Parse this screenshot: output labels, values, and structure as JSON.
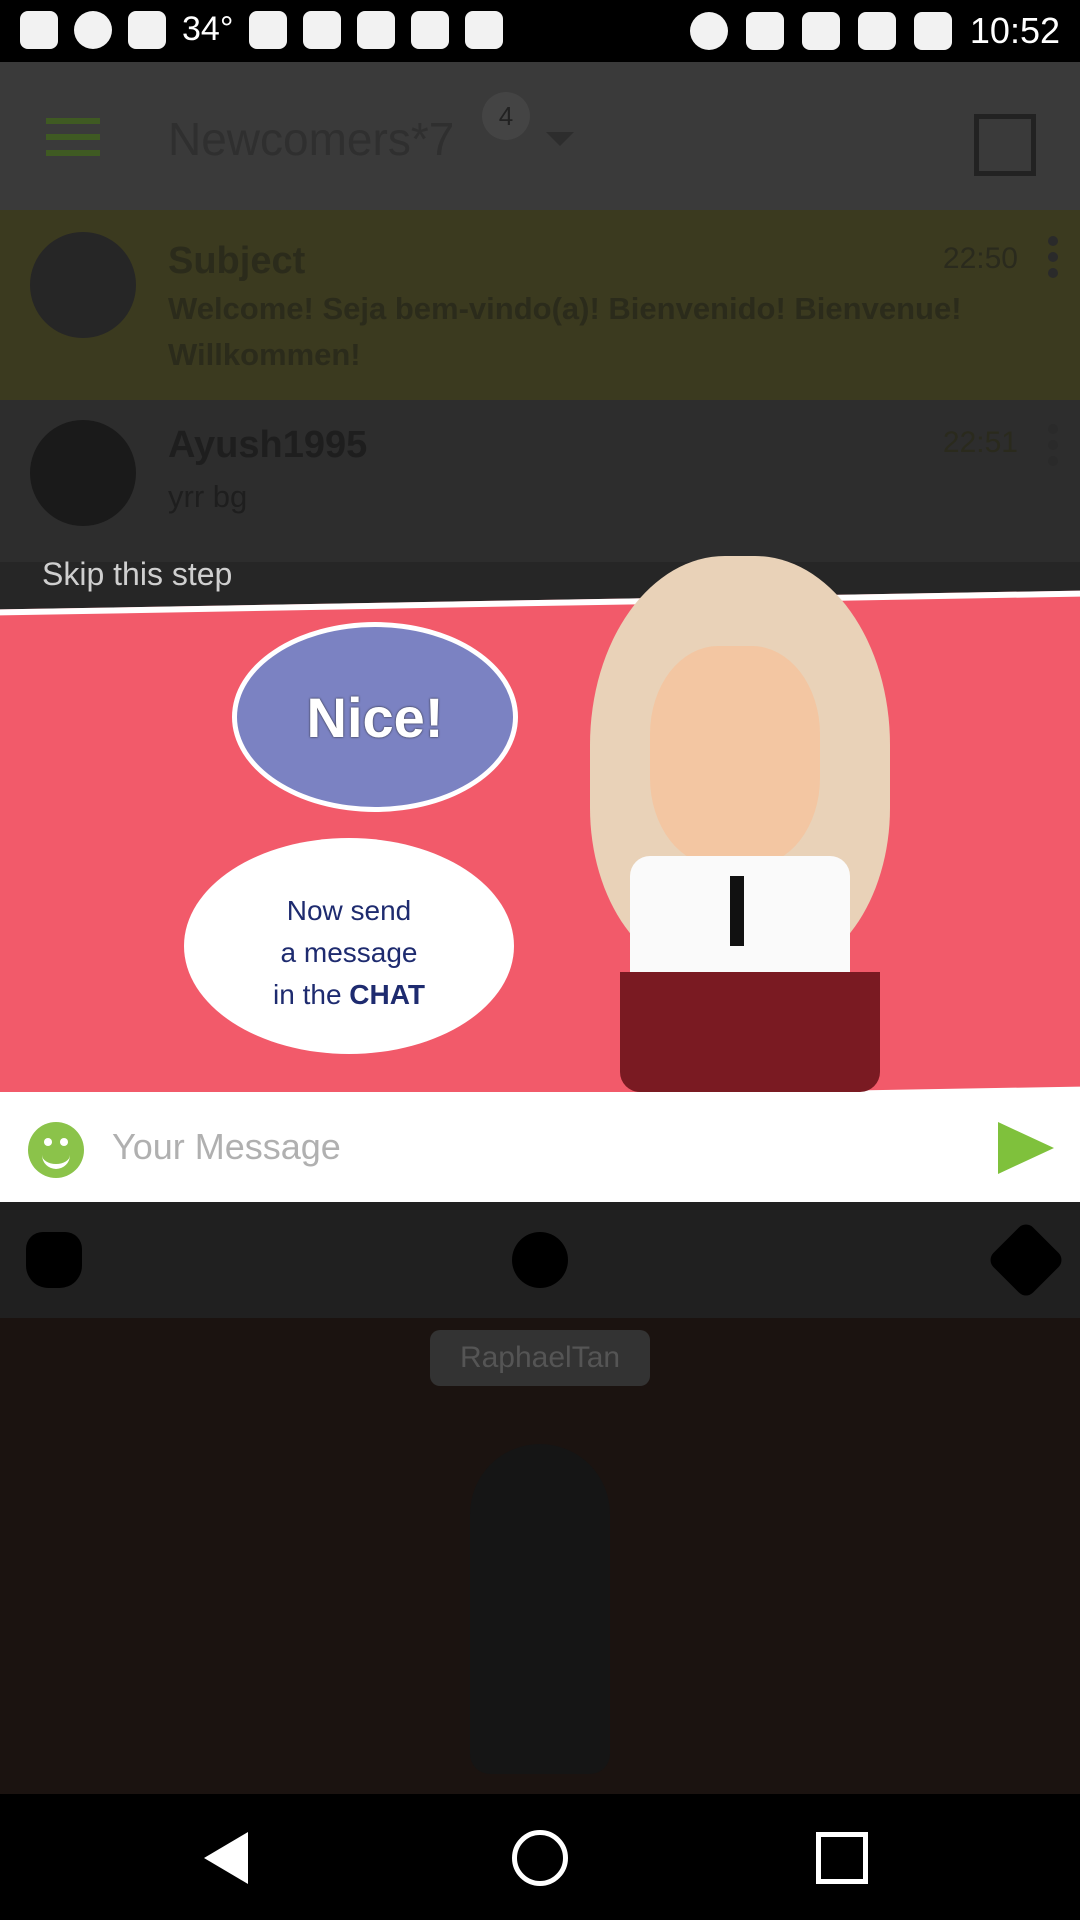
{
  "status_bar": {
    "temperature": "34°",
    "time": "10:52"
  },
  "header": {
    "title": "Newcomers*7",
    "badge_count": "4"
  },
  "conversations": [
    {
      "name": "Subject",
      "message": "Welcome! Seja bem-vindo(a)! Bienvenido! Bienvenue! Willkommen!",
      "time": "22:50"
    },
    {
      "name": "Ayush1995",
      "message": "yrr bg",
      "time": "22:51"
    }
  ],
  "tutorial": {
    "skip_label": "Skip this step",
    "bubble_nice": "Nice!",
    "bubble_line1": "Now send",
    "bubble_line2": "a message",
    "bubble_line3": "in the",
    "bubble_chat": "CHAT"
  },
  "composer": {
    "placeholder": "Your Message"
  },
  "profile": {
    "username": "RaphaelTan"
  },
  "icons": {
    "menu": "menu-icon",
    "copy": "copy-icon",
    "emoji": "emoji-icon",
    "send": "send-icon",
    "hand": "hand-icon",
    "person": "person-icon",
    "rocket": "rocket-icon",
    "back": "back-icon",
    "home": "home-icon",
    "recent": "recent-apps-icon"
  },
  "colors": {
    "banner": "#f25a6a",
    "send": "#7fc13c",
    "emoji": "#8bc34a",
    "nice_bubble": "#7b82c2"
  }
}
